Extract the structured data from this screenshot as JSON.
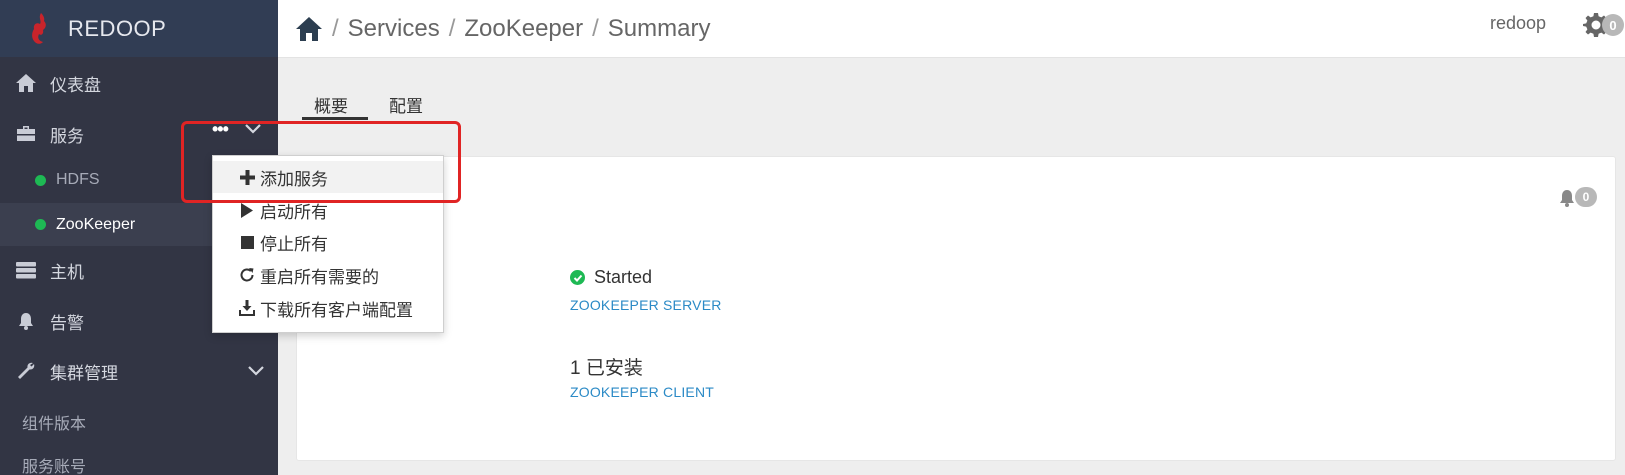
{
  "brand": {
    "name": "REDOOP"
  },
  "sidebar": {
    "items": [
      {
        "label": "仪表盘",
        "icon": "home-icon"
      },
      {
        "label": "服务",
        "icon": "briefcase-icon"
      },
      {
        "label": "主机",
        "icon": "server-icon"
      },
      {
        "label": "告警",
        "icon": "bell-icon"
      },
      {
        "label": "集群管理",
        "icon": "wrench-icon"
      }
    ],
    "services": [
      {
        "label": "HDFS",
        "status_color": "#1eb954"
      },
      {
        "label": "ZooKeeper",
        "status_color": "#1eb954"
      }
    ],
    "cluster_sub": [
      "组件版本",
      "服务账号"
    ],
    "more_actions": "•••"
  },
  "header": {
    "breadcrumb": [
      "Services",
      "ZooKeeper",
      "Summary"
    ],
    "separator": "/",
    "user": "redoop",
    "gear_badge": "0"
  },
  "tabs": [
    {
      "label": "概要",
      "active": true
    },
    {
      "label": "配置",
      "active": false
    }
  ],
  "summary": {
    "alert_badge": "0",
    "server_status": "Started",
    "server_label": "ZOOKEEPER SERVER",
    "client_count": "1 已安装",
    "client_label": "ZOOKEEPER CLIENT"
  },
  "dropdown": {
    "items": [
      {
        "label": "添加服务",
        "icon": "plus-icon"
      },
      {
        "label": "启动所有",
        "icon": "play-icon"
      },
      {
        "label": "停止所有",
        "icon": "stop-icon"
      },
      {
        "label": "重启所有需要的",
        "icon": "refresh-icon"
      },
      {
        "label": "下载所有客户端配置",
        "icon": "download-icon"
      }
    ]
  },
  "colors": {
    "sidebar": "#323544",
    "brand_bar": "#313d54",
    "accent_link": "#2b8ac6",
    "status_green": "#1eb954",
    "highlight": "#e02424"
  }
}
